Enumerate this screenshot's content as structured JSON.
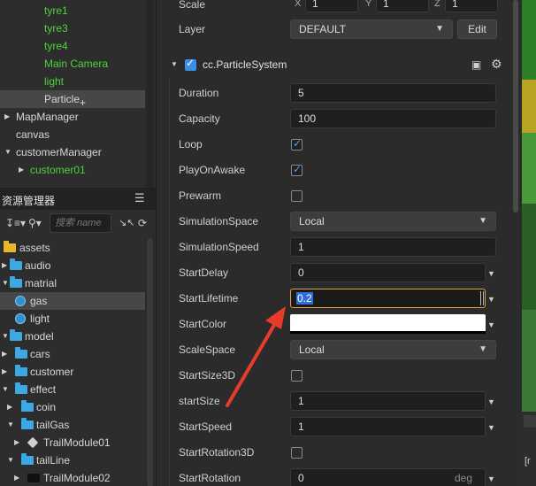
{
  "hierarchy": {
    "items": [
      {
        "label": "tyre1",
        "color": "green",
        "arrow": ""
      },
      {
        "label": "tyre3",
        "color": "green",
        "arrow": ""
      },
      {
        "label": "tyre4",
        "color": "green",
        "arrow": ""
      },
      {
        "label": "Main Camera",
        "color": "green",
        "arrow": ""
      },
      {
        "label": "light",
        "color": "green",
        "arrow": ""
      },
      {
        "label": "Particle",
        "color": "white",
        "arrow": "",
        "selected": true
      },
      {
        "label": "MapManager",
        "color": "white",
        "arrow": "right"
      },
      {
        "label": "canvas",
        "color": "white",
        "arrow": ""
      },
      {
        "label": "customerManager",
        "color": "white",
        "arrow": "down"
      },
      {
        "label": "customer01",
        "color": "green",
        "arrow": "right"
      }
    ],
    "drag_plus": "+"
  },
  "assets_panel": {
    "title": "资源管理器",
    "menu_icon": "hamburger-icon",
    "search_placeholder": "搜索 name",
    "sort_icon": "sort-icon",
    "items": [
      {
        "label": "assets",
        "icon": "bundle",
        "arrow": ""
      },
      {
        "label": "audio",
        "icon": "folder",
        "arrow": "right"
      },
      {
        "label": "matrial",
        "icon": "folder",
        "arrow": "down"
      },
      {
        "label": "gas",
        "icon": "globe",
        "arrow": "",
        "selected": true
      },
      {
        "label": "light",
        "icon": "globe",
        "arrow": ""
      },
      {
        "label": "model",
        "icon": "folder",
        "arrow": "down"
      },
      {
        "label": "cars",
        "icon": "folder",
        "arrow": "right"
      },
      {
        "label": "customer",
        "icon": "folder",
        "arrow": "right"
      },
      {
        "label": "effect",
        "icon": "folder",
        "arrow": "down"
      },
      {
        "label": "coin",
        "icon": "folder",
        "arrow": "right"
      },
      {
        "label": "tailGas",
        "icon": "folder",
        "arrow": "down"
      },
      {
        "label": "TrailModule01",
        "icon": "prefab",
        "arrow": "right"
      },
      {
        "label": "tailLine",
        "icon": "folder",
        "arrow": "down"
      },
      {
        "label": "TrailModule02",
        "icon": "black",
        "arrow": "right"
      }
    ]
  },
  "inspector": {
    "scale": {
      "label": "Scale",
      "x_label": "X",
      "x": "1",
      "y_label": "Y",
      "y": "1",
      "z_label": "Z",
      "z": "1"
    },
    "layer": {
      "label": "Layer",
      "value": "DEFAULT",
      "edit_label": "Edit"
    },
    "component": {
      "name": "cc.ParticleSystem"
    },
    "props": {
      "duration": {
        "label": "Duration",
        "value": "5"
      },
      "capacity": {
        "label": "Capacity",
        "value": "100"
      },
      "loop": {
        "label": "Loop",
        "checked": true
      },
      "playonawake": {
        "label": "PlayOnAwake",
        "checked": true
      },
      "prewarm": {
        "label": "Prewarm",
        "checked": false
      },
      "simulationspace": {
        "label": "SimulationSpace",
        "value": "Local"
      },
      "simulationspeed": {
        "label": "SimulationSpeed",
        "value": "1"
      },
      "startdelay": {
        "label": "StartDelay",
        "value": "0"
      },
      "startlifetime": {
        "label": "StartLifetime",
        "value": "0.2"
      },
      "startcolor": {
        "label": "StartColor",
        "color": "#ffffff"
      },
      "scalespace": {
        "label": "ScaleSpace",
        "value": "Local"
      },
      "startsize3d": {
        "label": "StartSize3D",
        "checked": false
      },
      "startsize": {
        "label": "startSize",
        "value": "1"
      },
      "startspeed": {
        "label": "StartSpeed",
        "value": "1"
      },
      "startrotation3d": {
        "label": "StartRotation3D",
        "checked": false
      },
      "startrotation": {
        "label": "StartRotation",
        "value": "0",
        "unit": "deg"
      }
    }
  },
  "scene": {
    "panel_text": "[r"
  },
  "annotation": {
    "arrow_color": "#ea3a2e"
  }
}
